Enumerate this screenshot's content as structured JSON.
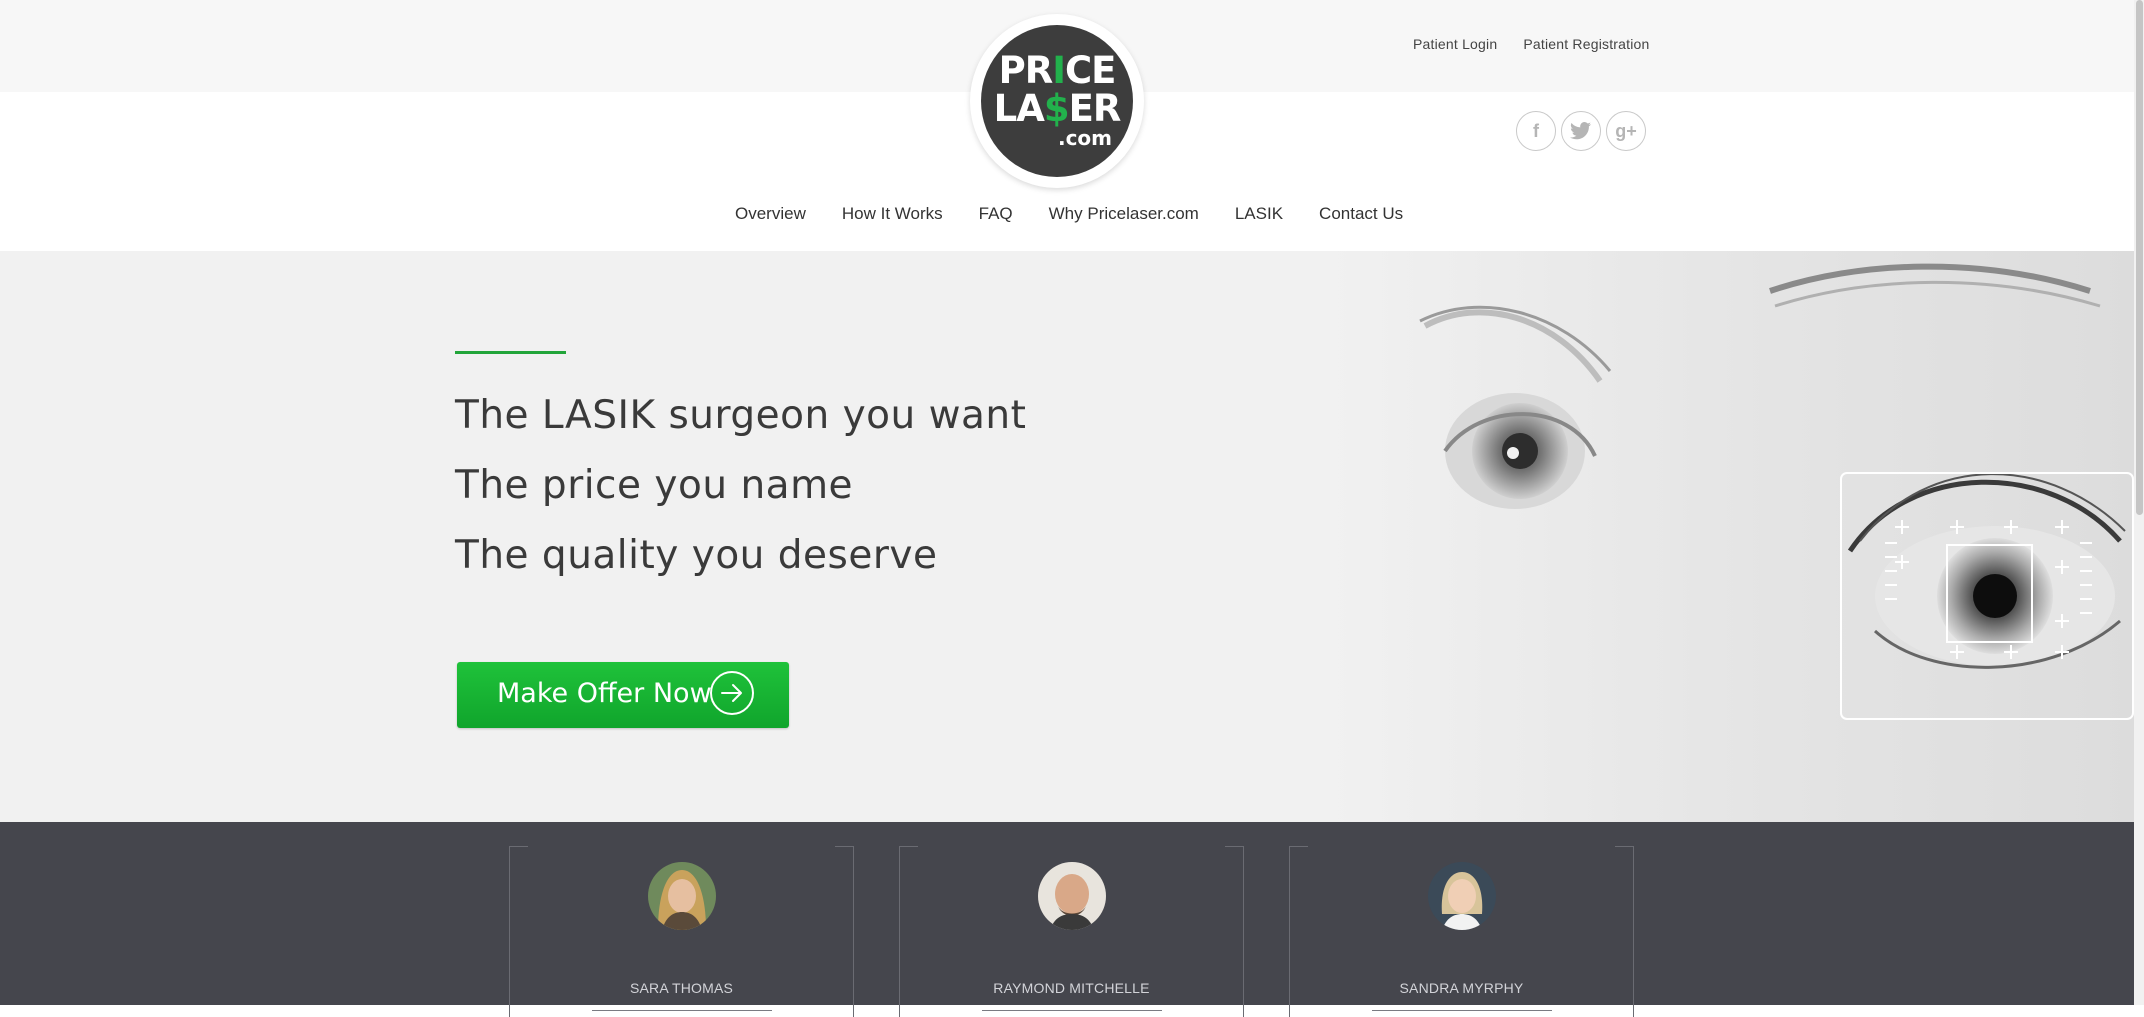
{
  "header": {
    "top_links": [
      "Patient Login",
      "Patient Registration"
    ],
    "logo": {
      "line1_a": "PR",
      "line1_b": "I",
      "line1_c": "CE",
      "line2_a": "LA",
      "line2_b": "$",
      "line2_c": "ER",
      "line3": ".com"
    },
    "social": [
      {
        "icon": "facebook-icon",
        "glyph": "f"
      },
      {
        "icon": "twitter-icon",
        "glyph": "t"
      },
      {
        "icon": "google-plus-icon",
        "glyph": "g+"
      }
    ],
    "nav": [
      "Overview",
      "How It Works",
      "FAQ",
      "Why Pricelaser.com",
      "LASIK",
      "Contact Us"
    ]
  },
  "hero": {
    "lines": [
      "The LASIK surgeon you want",
      "The price you name",
      "The quality you deserve"
    ],
    "cta_label": "Make Offer Now",
    "accent_color": "#22a53a"
  },
  "testimonials": [
    {
      "name": "SARA THOMAS"
    },
    {
      "name": "RAYMOND MITCHELLE"
    },
    {
      "name": "SANDRA MYRPHY"
    }
  ]
}
